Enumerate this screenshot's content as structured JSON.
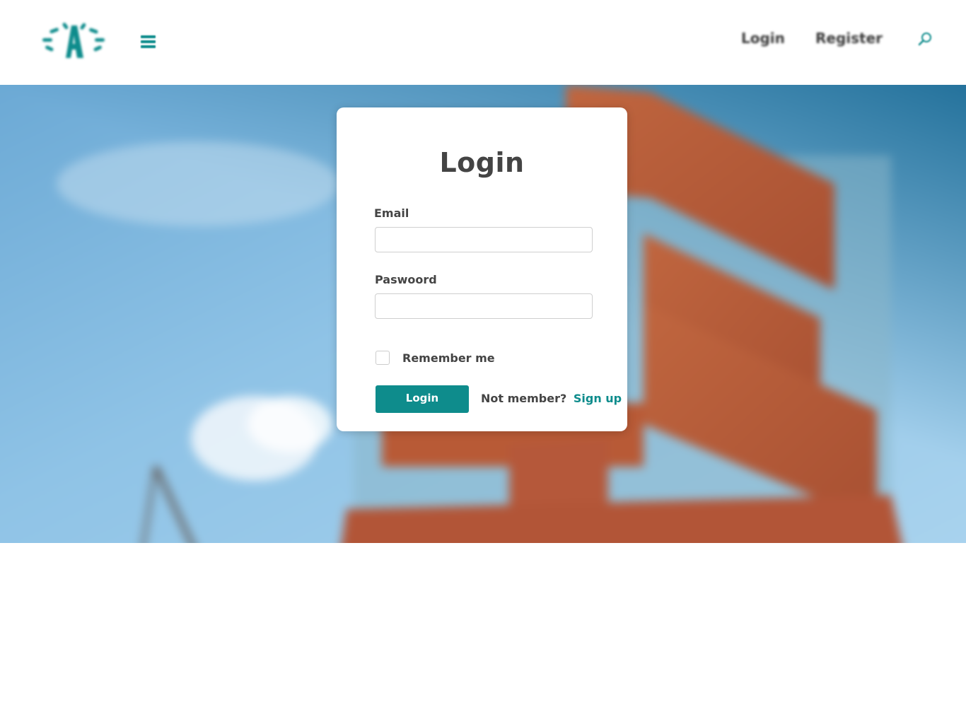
{
  "brand": {
    "logo_icon": "antwerp-a-logo",
    "accent_color": "#0e8c8c"
  },
  "header": {
    "menu_icon": "hamburger-menu-icon",
    "nav": {
      "login_label": "Login",
      "register_label": "Register"
    },
    "search_icon": "search-icon"
  },
  "hero": {
    "background": "blurred-brick-tower-photo"
  },
  "login_form": {
    "title": "Login",
    "email_label": "Email",
    "email_value": "",
    "password_label": "Paswoord",
    "password_value": "",
    "remember_label": "Remember me",
    "remember_checked": false,
    "submit_label": "Login",
    "not_member_text": "Not member?",
    "signup_label": "Sign up"
  }
}
